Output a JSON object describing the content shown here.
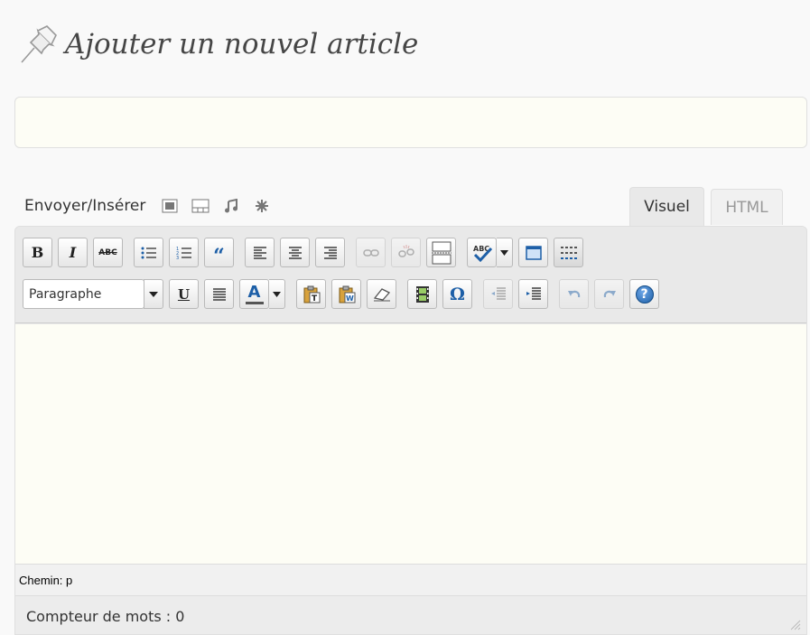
{
  "header": {
    "title": "Ajouter un nouvel article",
    "icon": "pushpin-icon"
  },
  "title_field": {
    "value": "",
    "placeholder": ""
  },
  "media": {
    "label": "Envoyer/Insérer",
    "icons": [
      "image-icon",
      "video-icon",
      "audio-icon",
      "media-icon"
    ]
  },
  "tabs": {
    "visual": "Visuel",
    "html": "HTML",
    "active": "visual"
  },
  "toolbar": {
    "format_select": "Paragraphe",
    "bold": "B",
    "italic": "I",
    "strike": "ABC",
    "quote": "“",
    "underline": "U",
    "font_color": "A",
    "special_char": "Ω",
    "help": "?"
  },
  "path": "Chemin: p",
  "word_count": "Compteur de mots : 0",
  "colors": {
    "accent": "#21759b",
    "content_bg": "#fdfdf5"
  }
}
